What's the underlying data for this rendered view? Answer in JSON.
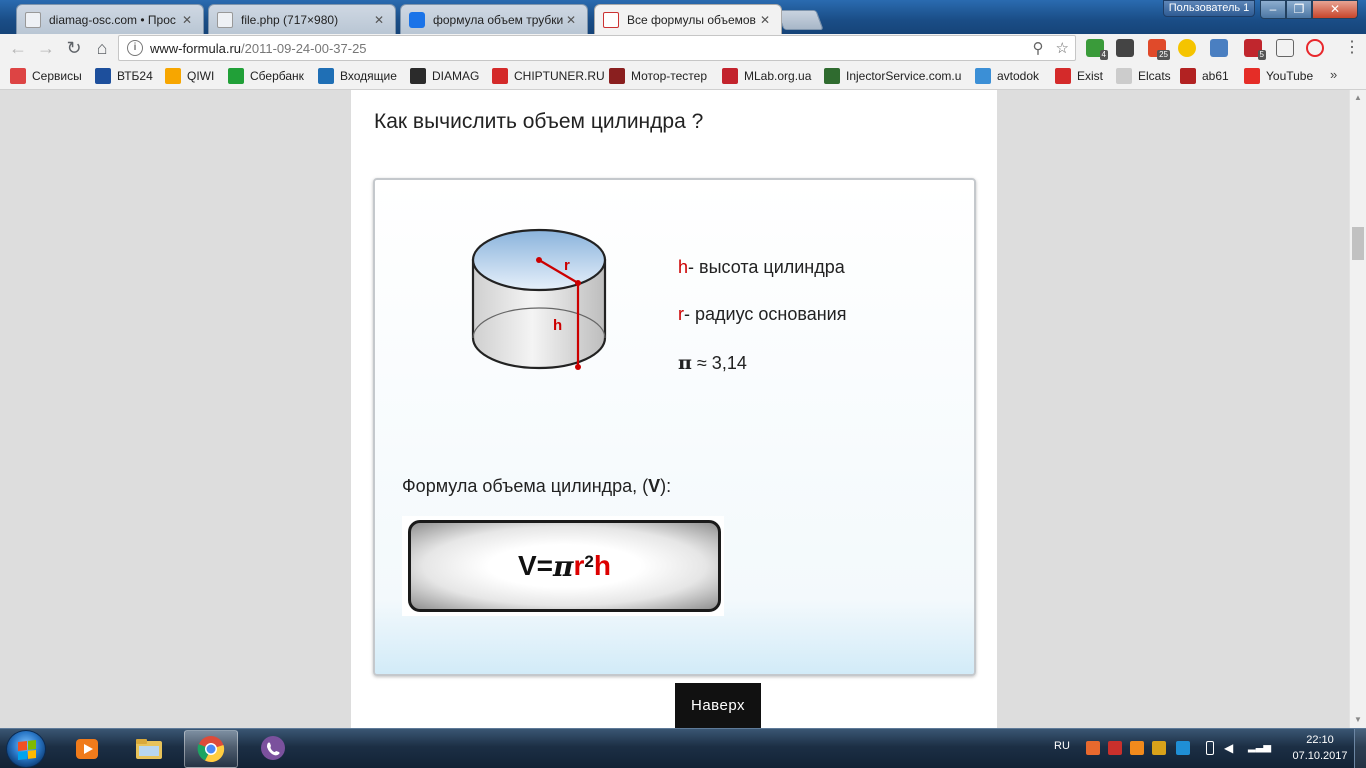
{
  "browser": {
    "tabs": [
      {
        "title": "diamag-osc.com • Прос",
        "favicon": "document-icon"
      },
      {
        "title": "file.php (717×980)",
        "favicon": "document-icon"
      },
      {
        "title": "формула объем трубки",
        "favicon": "search-icon"
      },
      {
        "title": "Все формулы объемов",
        "favicon": "formula-site-icon",
        "active": true
      }
    ],
    "user_label": "Пользователь 1",
    "window_buttons": {
      "minimize": "–",
      "maximize": "❐",
      "close": "✕"
    },
    "url": {
      "host": "www-formula.ru",
      "path": "/2011-09-24-00-37-25"
    },
    "extensions": [
      {
        "name": "leaf-extension-icon",
        "badge": "4",
        "color": "#3a9b3a"
      },
      {
        "name": "location-extension-icon",
        "badge": "",
        "color": "#444444"
      },
      {
        "name": "mail-extension-icon",
        "badge": "25",
        "color": "#e04a2a"
      },
      {
        "name": "m-extension-icon",
        "badge": "",
        "color": "#f5c400"
      },
      {
        "name": "translate-extension-icon",
        "badge": "",
        "color": "#4a7fc1"
      },
      {
        "name": "shield-extension-icon",
        "badge": "5",
        "color": "#c0262d"
      },
      {
        "name": "clipboard-extension-icon",
        "badge": "",
        "color": "#666666"
      },
      {
        "name": "adblock-extension-icon",
        "badge": "",
        "color": "#e8272c"
      }
    ],
    "bookmarks": [
      {
        "label": "Сервисы",
        "icon": "apps-grid-icon",
        "color": "#d44"
      },
      {
        "label": "ВТБ24",
        "icon": "vtb-icon",
        "color": "#1d4f9c"
      },
      {
        "label": "QIWI",
        "icon": "qiwi-icon",
        "color": "#f7a600"
      },
      {
        "label": "Сбербанк",
        "icon": "sberbank-icon",
        "color": "#21a038"
      },
      {
        "label": "Входящие",
        "icon": "mail-icon",
        "color": "#1f6fb5"
      },
      {
        "label": "DIAMAG",
        "icon": "diamag-icon",
        "color": "#2b2b2b"
      },
      {
        "label": "CHIPTUNER.RU",
        "icon": "chiptuner-icon",
        "color": "#d42a2a"
      },
      {
        "label": "Мотор-тестер",
        "icon": "motor-tester-icon",
        "color": "#8a1f1f"
      },
      {
        "label": "MLab.org.ua",
        "icon": "car-icon",
        "color": "#c3232d"
      },
      {
        "label": "InjectorService.com.u",
        "icon": "injector-icon",
        "color": "#2f6b2f"
      },
      {
        "label": "avtodok",
        "icon": "avtodok-icon",
        "color": "#3b8fd6"
      },
      {
        "label": "Exist",
        "icon": "exist-icon",
        "color": "#d42a2a"
      },
      {
        "label": "Elcats",
        "icon": "page-icon",
        "color": "#cccccc"
      },
      {
        "label": "ab61",
        "icon": "gear-icon",
        "color": "#b22222"
      },
      {
        "label": "YouTube",
        "icon": "youtube-icon",
        "color": "#e52d27"
      }
    ],
    "bookmarks_more": "»"
  },
  "page": {
    "section_title": "Как вычислить объем цилиндра ?",
    "figure_labels": {
      "r": "r",
      "h": "h"
    },
    "legend": {
      "h_symbol": "h",
      "h_text": "- высота цилиндра",
      "r_symbol": "r",
      "r_text": "- радиус основания",
      "pi_symbol": "π",
      "pi_text": " ≈ 3,14"
    },
    "formula_caption": {
      "before": "Формула объема цилиндра, (",
      "var": "V",
      "after": "):"
    },
    "formula": {
      "lhs": "V=",
      "pi": "π",
      "r": "r",
      "exp": "2",
      "h": "h"
    },
    "to_top_label": "Наверх"
  },
  "taskbar": {
    "apps": [
      {
        "name": "media-player-icon",
        "color": "#f07b1b"
      },
      {
        "name": "file-explorer-icon",
        "color": "#e8c35a"
      },
      {
        "name": "chrome-icon",
        "color": "#dd4b39",
        "active": true
      },
      {
        "name": "viber-icon",
        "color": "#7b519d"
      }
    ],
    "language": "RU",
    "time": "22:10",
    "date": "07.10.2017"
  }
}
